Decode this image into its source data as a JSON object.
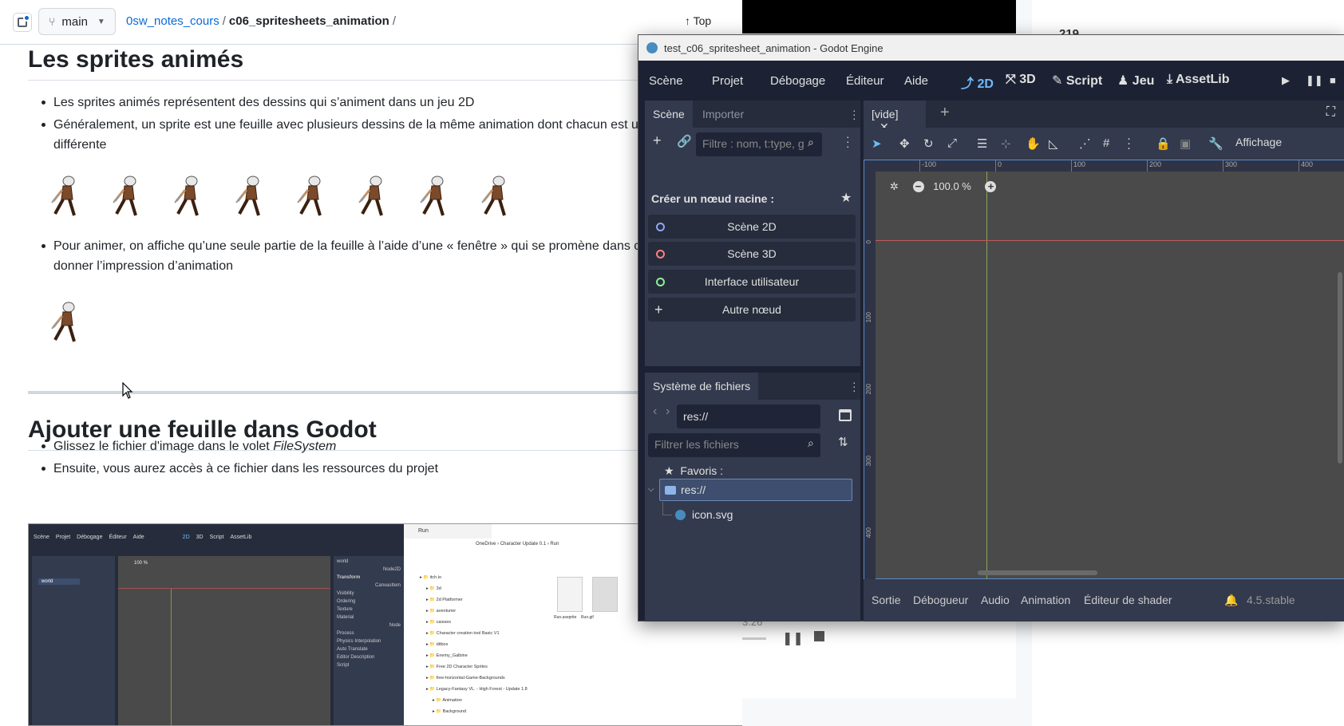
{
  "browser": {
    "branch": "main",
    "repo": "0sw_notes_cours",
    "folder": "c06_spritesheets_animation",
    "top_label": "Top"
  },
  "doc": {
    "h1_sprites": "Les sprites animés",
    "bullet1": "Les sprites animés représentent des dessins qui s’animent dans un jeu 2D",
    "bullet2a": "Généralement, un sprite est une feuille avec plusieurs dessins de la même animation dont chacun est un",
    "bullet2b": "différente",
    "bullet3a": "Pour animer, on affiche qu’une seule partie de la feuille à l’aide d’une « fenêtre » qui se promène dans ce",
    "bullet3b": "donner l’impression d’animation",
    "h1_godot": "Ajouter une feuille dans Godot",
    "bullet4_prefix": "Glissez le fichier d'image dans le volet",
    "bullet4_em": "FileSystem",
    "bullet5": "Ensuite, vous aurez accès à ce fichier dans les ressources du projet"
  },
  "mini": {
    "menu": [
      "Scène",
      "Projet",
      "Débogage",
      "Éditeur",
      "Aide"
    ],
    "ws": [
      "2D",
      "3D",
      "Script",
      "AssetLib"
    ],
    "world": "world",
    "zoom": "100 %",
    "node2d": "Node2D",
    "transform": "Transform",
    "canvasitem": "CanvasItem",
    "props": [
      "Visibility",
      "Ordering",
      "Texture",
      "Material"
    ],
    "node": "Node",
    "props2": [
      "Process",
      "Physics Interpolation",
      "Auto Translate",
      "Editor Description"
    ],
    "script": "Script",
    "fx_tab": "Run",
    "fx_path": [
      "OneDrive",
      "Character Update 0.1",
      "Run"
    ],
    "fx_tree": [
      "itch.io",
      "3d",
      "2d Platformer",
      "aventurier",
      "caisses",
      "Character creation tool Basic V1",
      "ditbox",
      "Enemy_Galbine",
      "Free 2D Character Sprites",
      "free-horizontal-Game-Backgrounds",
      "Legacy-Fantasy VL. - High Forest - Update 1.8",
      "Animation",
      "Background"
    ],
    "fx_files": [
      "Run.aseprite",
      "Run.gif"
    ]
  },
  "music": {
    "temp": "219",
    "time": "3:26"
  },
  "godot": {
    "title": "test_c06_spritesheet_animation - Godot Engine",
    "menu": [
      "Scène",
      "Projet",
      "Débogage",
      "Éditeur",
      "Aide"
    ],
    "workspaces": [
      "2D",
      "3D",
      "Script",
      "Jeu",
      "AssetLib"
    ],
    "scene_tab": "Scène",
    "import_tab": "Importer",
    "filter_placeholder": "Filtre : nom, t:type, g",
    "create_root": "Créer un nœud racine :",
    "root_buttons": [
      "Scène 2D",
      "Scène 3D",
      "Interface utilisateur",
      "Autre nœud"
    ],
    "fs_tab": "Système de fichiers",
    "fs_path": "res://",
    "fs_filter": "Filtrer les fichiers",
    "favorites": "Favoris :",
    "res": "res://",
    "icon_file": "icon.svg",
    "viewport_tab": "[vide]",
    "affichage": "Affichage",
    "zoom": "100.0 %",
    "ruler_h": [
      "-100",
      "0",
      "100",
      "200",
      "300",
      "400"
    ],
    "ruler_v": [
      "0",
      "100",
      "200",
      "300",
      "400"
    ],
    "bottom_tabs": [
      "Sortie",
      "Débogueur",
      "Audio",
      "Animation",
      "Éditeur de shader"
    ],
    "version": "4.5.stable"
  },
  "colors": {
    "link": "#0969da",
    "godot_accent": "#70bafa",
    "godot_bg": "#1c2233",
    "godot_panel": "#333a4d"
  }
}
